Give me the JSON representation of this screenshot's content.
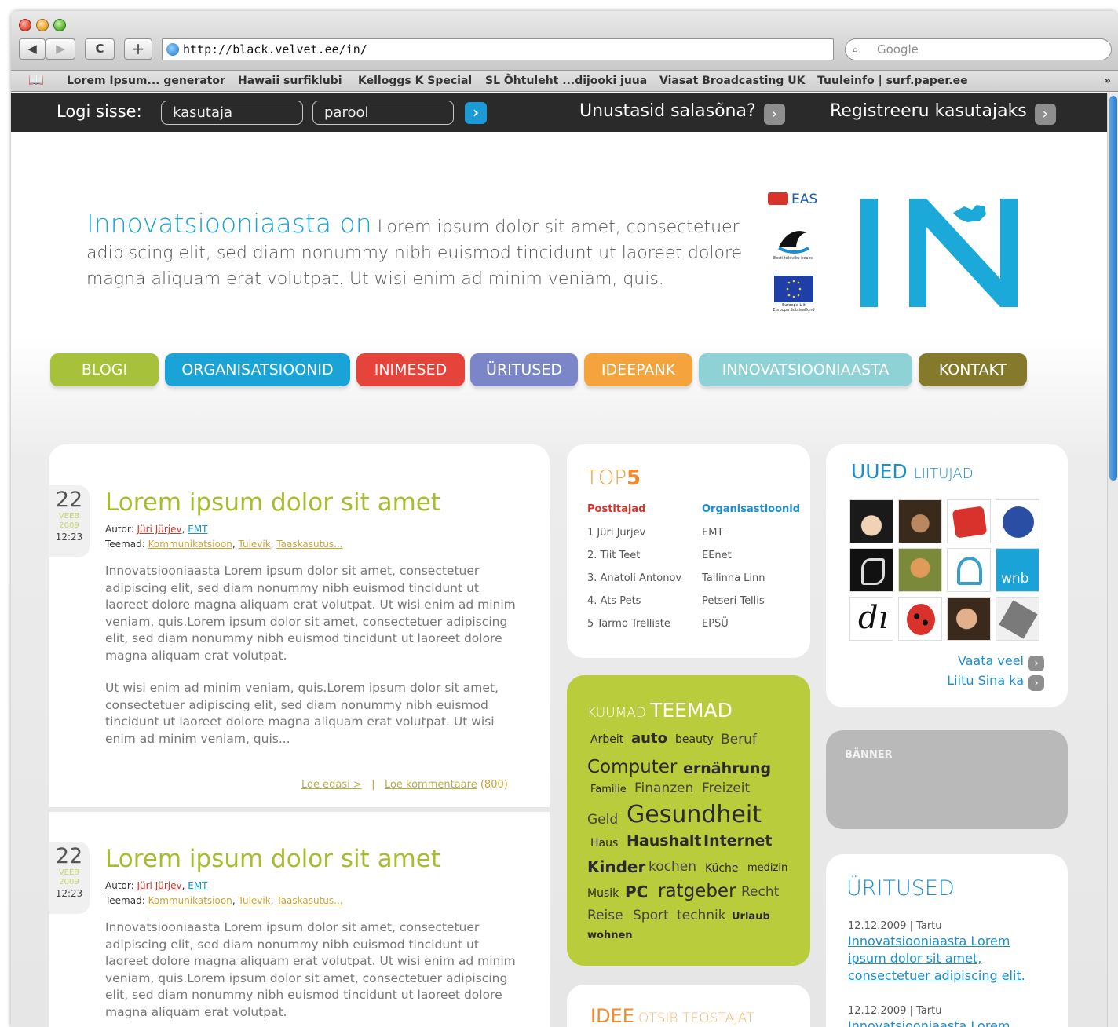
{
  "browser": {
    "url": "http://black.velvet.ee/in/",
    "search_placeholder": "Google",
    "bookmarks": [
      "Lorem Ipsum... generator",
      "Hawaii surfiklubi",
      "Kelloggs K Special",
      "SL Õhtuleht ...dijooki juua",
      "Viasat Broadcasting UK",
      "Tuuleinfo | surf.paper.ee"
    ],
    "overflow": "»",
    "back": "◀",
    "forward": "▶",
    "reload": "C",
    "add": "+"
  },
  "login": {
    "label": "Logi sisse:",
    "username_placeholder": "kasutaja",
    "password_placeholder": "parool",
    "go": "›",
    "forgot": "Unustasid salasõna?",
    "register": "Registreeru kasutajaks"
  },
  "intro": {
    "lead": "Innovatsiooniaasta on",
    "text": "Lorem ipsum dolor sit amet, consectetuer adipiscing elit, sed diam nonummy nibh euismod tincidunt ut laoreet dolore magna aliquam erat volutpat. Ut wisi enim ad minim veniam, quis."
  },
  "logos": {
    "eas": "EAS",
    "ship_caption": "Eesti tuleviku heaks",
    "eu_caption1": "Euroopa Liit",
    "eu_caption2": "Euroopa Sotsiaalfond"
  },
  "nav": [
    {
      "label": "BLOGI",
      "color": "#a7c23a"
    },
    {
      "label": "ORGANISATSIOONID",
      "color": "#1aa3d6"
    },
    {
      "label": "INIMESED",
      "color": "#e6443a"
    },
    {
      "label": "ÜRITUSED",
      "color": "#7b86c8"
    },
    {
      "label": "IDEEPANK",
      "color": "#f4a33d"
    },
    {
      "label": "INNOVATSIOONIAASTA",
      "color": "#8fd2d6"
    },
    {
      "label": "KONTAKT",
      "color": "#857a2c"
    }
  ],
  "posts": [
    {
      "day": "22",
      "month": "VEEB",
      "year": "2009",
      "time": "12:23",
      "title": "Lorem ipsum dolor sit amet",
      "author_label": "Autor:",
      "author": "Jüri Jürjev",
      "author_org": "EMT",
      "topics_label": "Teemad:",
      "topics": [
        "Kommunikatsioon",
        "Tulevik",
        "Taaskasutus..."
      ],
      "p1": "Innovatsiooniaasta Lorem ipsum dolor sit amet, consectetuer adipiscing elit, sed diam nonummy nibh euismod tincidunt ut laoreet dolore magna aliquam erat volutpat. Ut wisi enim ad minim veniam, quis.Lorem ipsum dolor sit amet, consectetuer adipiscing elit, sed diam nonummy nibh euismod tincidunt ut laoreet dolore magna aliquam erat volutpat.",
      "p2": "Ut wisi enim ad minim veniam, quis.Lorem ipsum dolor sit amet, consectetuer adipiscing elit, sed diam nonummy nibh euismod tincidunt ut laoreet dolore magna aliquam erat volutpat. Ut wisi enim ad minim veniam, quis...",
      "read_more": "Loe edasi >",
      "separator": "|",
      "comments": "Loe kommentaare",
      "comment_count": "(800)"
    },
    {
      "day": "22",
      "month": "VEEB",
      "year": "2009",
      "time": "12:23",
      "title": "Lorem ipsum dolor sit amet",
      "author_label": "Autor:",
      "author": "Jüri Jürjev",
      "author_org": "EMT",
      "topics_label": "Teemad:",
      "topics": [
        "Kommunikatsioon",
        "Tulevik",
        "Taaskasutus..."
      ],
      "p1": "Innovatsiooniaasta Lorem ipsum dolor sit amet, consectetuer adipiscing elit, sed diam nonummy nibh euismod tincidunt ut laoreet dolore magna aliquam erat volutpat. Ut wisi enim ad minim veniam, quis.Lorem ipsum dolor sit amet, consectetuer adipiscing elit, sed diam nonummy nibh euismod tincidunt ut laoreet dolore magna aliquam erat volutpat."
    }
  ],
  "top5": {
    "title_a": "TOP",
    "title_b": "5",
    "col1_head": "Postitajad",
    "col2_head": "Organisastioonid",
    "posters": [
      "1 Jüri Jurjev",
      "2. Tiit Teet",
      "3. Anatoli Antonov",
      "4. Ats Pets",
      "5 Tarmo Trelliste"
    ],
    "orgs": [
      "EMT",
      "EEnet",
      "Tallinna Linn",
      "Petseri Tellis",
      "EPSÜ"
    ]
  },
  "topics": {
    "title_a": "KUUMAD",
    "title_b": "TEEMAD",
    "tags": [
      "Arbeit",
      "auto",
      "beauty",
      "Beruf",
      "Computer",
      "ernährung",
      "Familie",
      "Finanzen",
      "Freizeit",
      "Geld",
      "Gesundheit",
      "Haus",
      "Haushalt",
      "Internet",
      "Kinder",
      "kochen",
      "Küche",
      "medizin",
      "Musik",
      "PC",
      "ratgeber",
      "Recht",
      "Reise",
      "Sport",
      "technik",
      "Urlaub",
      "wohnen"
    ]
  },
  "idea": {
    "title_a": "IDEE",
    "title_b": "OTSIB TEOSTAJAT"
  },
  "users": {
    "title_a": "UUED",
    "title_b": "LIITUJAD",
    "wnb": "wnb",
    "see_more": "Vaata veel",
    "join": "Liitu Sina ka"
  },
  "banner": {
    "label": "BÄNNER"
  },
  "events": {
    "title": "ÜRITUSED",
    "items": [
      {
        "date": "12.12.2009 | Tartu",
        "text": "Innovatsiooniaasta Lorem ipsum dolor sit amet, consectetuer adipiscing elit."
      },
      {
        "date": "12.12.2009 | Tartu",
        "text": "Innovatsiooniaasta Lorem"
      }
    ]
  }
}
